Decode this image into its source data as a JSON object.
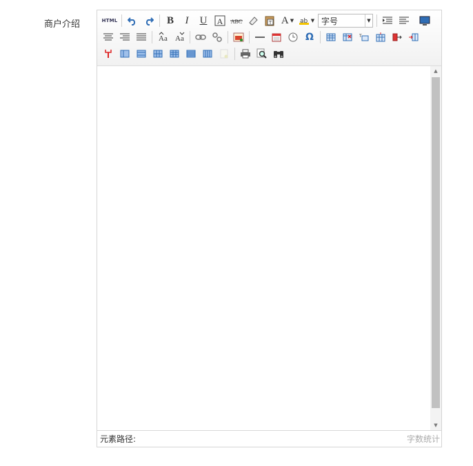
{
  "field": {
    "label": "商户介绍"
  },
  "toolbar": {
    "html_label": "HTML",
    "bold": "B",
    "italic": "I",
    "underline": "U",
    "fontsize_value": "字号",
    "font_color_glyph": "A",
    "omega": "Ω"
  },
  "statusbar": {
    "element_path_label": "元素路径:",
    "word_count_label": "字数统计"
  },
  "colors": {
    "border": "#d4d4d4",
    "icon_blue": "#2f6db5",
    "scroll_thumb": "#c1c1c1"
  }
}
